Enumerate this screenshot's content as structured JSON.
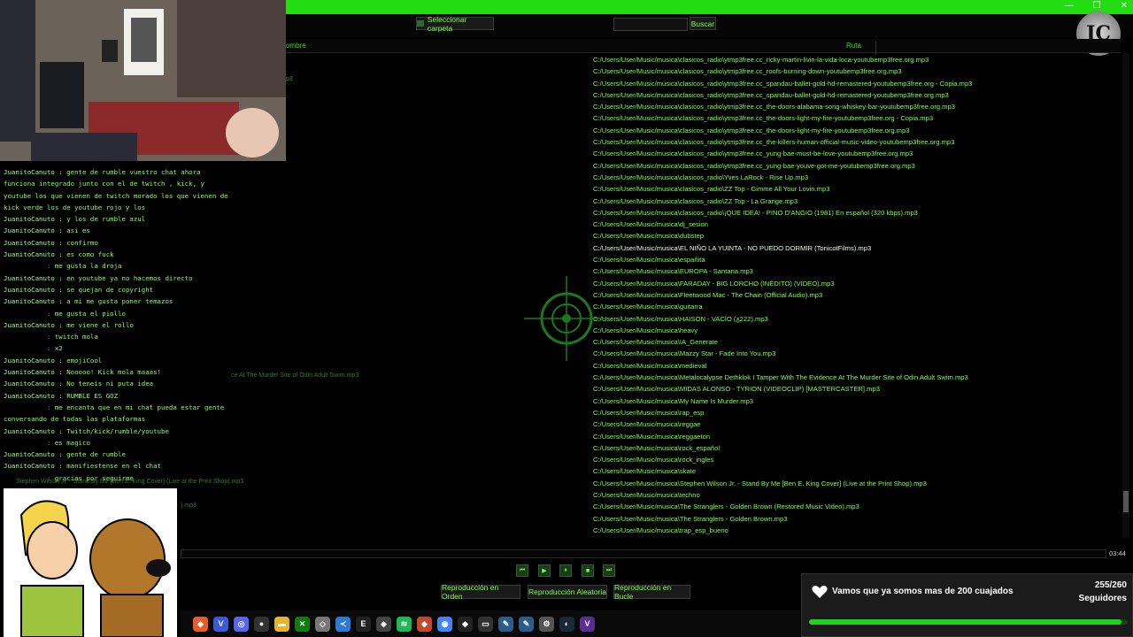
{
  "window": {
    "minimize": "—",
    "maximize": "❐",
    "close": "✕"
  },
  "toolbar": {
    "select_folder": "Seleccionar carpeta",
    "search_value": "",
    "search_button": "Buscar"
  },
  "table": {
    "col_name": "ombre",
    "col_path": "Ruta",
    "rows": [
      "C:/Users/User/Music/musica\\clasicos_radio\\ytmp3free.cc_ricky-martin-livin-la-vida-loca-youtubemp3free.org.mp3",
      "C:/Users/User/Music/musica\\clasicos_radio\\ytmp3free.cc_roofs-burning-down-youtubemp3free.org.mp3",
      "C:/Users/User/Music/musica\\clasicos_radio\\ytmp3free.cc_spandau-ballet-gold-hd-remastered-youtubemp3free.org - Copia.mp3",
      "C:/Users/User/Music/musica\\clasicos_radio\\ytmp3free.cc_spandau-ballet-gold-hd-remastered-youtubemp3free.org.mp3",
      "C:/Users/User/Music/musica\\clasicos_radio\\ytmp3free.cc_the-doors-alabama-song-whiskey-bar-youtubemp3free.org.mp3",
      "C:/Users/User/Music/musica\\clasicos_radio\\ytmp3free.cc_the-doors-light-my-fire-youtubemp3free.org - Copia.mp3",
      "C:/Users/User/Music/musica\\clasicos_radio\\ytmp3free.cc_the-doors-light-my-fire-youtubemp3free.org.mp3",
      "C:/Users/User/Music/musica\\clasicos_radio\\ytmp3free.cc_the-killers-human-official-music-video-youtubemp3free.org.mp3",
      "C:/Users/User/Music/musica\\clasicos_radio\\ytmp3free.cc_yung-bae-must-be-love-youtubemp3free.org.mp3",
      "C:/Users/User/Music/musica\\clasicos_radio\\ytmp3free.cc_yung-bae-youve-got-me-youtubemp3free.org.mp3",
      "C:/Users/User/Music/musica\\clasicos_radio\\Yves LaRock - Rise Up.mp3",
      "C:/Users/User/Music/musica\\clasicos_radio\\ZZ Top - Gimme All Your Lovin.mp3",
      "C:/Users/User/Music/musica\\clasicos_radio\\ZZ Top - La Grange.mp3",
      "C:/Users/User/Music/musica\\clasicos_radio\\¡QUE IDEA! - PINO D'ANGIO (1981) En español (320 kbps).mp3",
      "C:/Users/User/Music/musica\\dj_sesion",
      "C:/Users/User/Music/musica\\dubstep",
      "C:/Users/User/Music/musica\\EL NIÑO LA YUINTA - NO PUEDO DORMIR (TonicotFilms).mp3",
      "C:/Users/User/Music/musica\\españita",
      "C:/Users/User/Music/musica\\EUROPA - Santana.mp3",
      "C:/Users/User/Music/musica\\FARADAY - BIG LORCHO (INÉDITO) (VIDEO).mp3",
      "C:/Users/User/Music/musica\\Fleetwood Mac - The Chain (Official Audio).mp3",
      "C:/Users/User/Music/musica\\guitarra",
      "C:/Users/User/Music/musica\\HAISON - VACÍO (ᵹ222).mp3",
      "C:/Users/User/Music/musica\\heavy",
      "C:/Users/User/Music/musica\\IA_Generate",
      "C:/Users/User/Music/musica\\Mazzy Star - Fade Into You.mp3",
      "C:/Users/User/Music/musica\\medieval",
      "C:/Users/User/Music/musica\\Metalocalypse Dethklok I Tamper With The Evidence At The Murder Site of Odin Adult Swim.mp3",
      "C:/Users/User/Music/musica\\MIDAS ALONSO - TYRION (VIDEOCLIP) [MASTERCASTER].mp3",
      "C:/Users/User/Music/musica\\My Name Is Murder.mp3",
      "C:/Users/User/Music/musica\\rap_esp",
      "C:/Users/User/Music/musica\\reggae",
      "C:/Users/User/Music/musica\\reggaeton",
      "C:/Users/User/Music/musica\\rock_español",
      "C:/Users/User/Music/musica\\rock_ingles",
      "C:/Users/User/Music/musica\\skate",
      "C:/Users/User/Music/musica\\Stephen Wilson Jr. - Stand By Me [Ben E. King Cover] (Live at the Print Shop).mp3",
      "C:/Users/User/Music/musica\\techno",
      "C:/Users/User/Music/musica\\The Stranglers - Golden Brown (Restored Music Video).mp3",
      "C:/Users/User/Music/musica\\The Stranglers - Golden Brown.mp3",
      "C:/Users/User/Music/musica\\trap_esp_bueno"
    ],
    "left_fragments": {
      "mp3": "p3",
      "odin": "ce At The Murder Site of Odin Adult Swim.mp3",
      "stephen": "Stephen Wilson Jr. - Stand By Me [Ben E. King Cover] (Live at the Print Shop).mp3",
      "mp3b": ").mp3"
    }
  },
  "chat": [
    {
      "user": "JuanitoCanuto",
      "text": "gente de rumble vuestro chat ahora funciona integrado junto con el de twitch , kick, y youtube los que vienen de twitch morado los que vienen de kick verde los de youtube rojo y los"
    },
    {
      "user": "JuanitoCanuto",
      "text": "y los de rumble azul"
    },
    {
      "user": "JuanitoCanuto",
      "text": "asi es"
    },
    {
      "user": "JuanitoCanuto",
      "text": "confirmo"
    },
    {
      "user": "JuanitoCanuto",
      "text": "es como fuck"
    },
    {
      "user": "",
      "text": "me gusta la droja"
    },
    {
      "user": "JuanitoCanuto",
      "text": "en youtube ya no hacemos directo"
    },
    {
      "user": "JuanitoCanuto",
      "text": "se quejan de copyright"
    },
    {
      "user": "JuanitoCanuto",
      "text": "a mi me gusta poner temazos"
    },
    {
      "user": "",
      "text": "me gusta el piollo"
    },
    {
      "user": "JuanitoCanuto",
      "text": "me viene el rollo"
    },
    {
      "user": "",
      "text": "twitch mola"
    },
    {
      "user": "",
      "text": "x2"
    },
    {
      "user": "JuanitoCanuto",
      "text": "emojiCool"
    },
    {
      "user": "JuanitoCanuto",
      "text": "Nooooo! Kick mola maaas!"
    },
    {
      "user": "JuanitoCanuto",
      "text": "No teneis ni puta idea"
    },
    {
      "user": "JuanitoCanuto",
      "text": "RUMBLE ES GOZ"
    },
    {
      "user": "",
      "text": "me encanta que en mi chat pueda estar gente conversando de todas las plataformas"
    },
    {
      "user": "JuanitoCanuto",
      "text": "Twitch/kick/rumble/youtube"
    },
    {
      "user": "",
      "text": "es magico"
    },
    {
      "user": "JuanitoCanuto",
      "text": "gente de rumble"
    },
    {
      "user": "JuanitoCanuto",
      "text": "manifiestense en el chat"
    },
    {
      "user": "",
      "text": "gracias por seguirme"
    }
  ],
  "player": {
    "time": "03:44",
    "progress": 0.0,
    "modes": [
      "Reproducción en Orden",
      "Reproducción Aleatoria",
      "Reproducción en Bucle"
    ]
  },
  "goal": {
    "title": "Vamos que ya somos mas de 200 cuajados",
    "count": "255/260",
    "label": "Seguidores",
    "fraction": 0.98
  },
  "colors": {
    "accent": "#22dd11",
    "text": "#7CFF4C",
    "goal_fill": "#1ed21e"
  },
  "taskbar_icons": [
    "brave-icon",
    "v-icon",
    "discord-icon",
    "obs-icon",
    "folder-icon",
    "xbox-icon",
    "box-icon",
    "vscode-icon",
    "epic-icon",
    "unity-icon",
    "spotify-icon",
    "lion-icon",
    "chrome-icon",
    "github-icon",
    "terminal-icon",
    "pen-icon",
    "pen2-icon",
    "settings-icon",
    "steam-icon",
    "vs-icon"
  ]
}
